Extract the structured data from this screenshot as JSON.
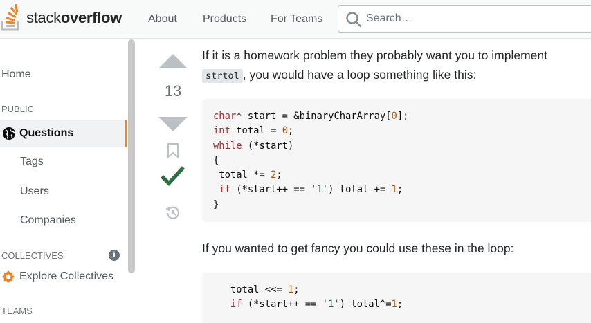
{
  "header": {
    "logo": {
      "light": "stack",
      "bold": "overflow"
    },
    "nav": [
      "About",
      "Products",
      "For Teams"
    ],
    "search_placeholder": "Search…"
  },
  "sidebar": {
    "home": "Home",
    "public_heading": "PUBLIC",
    "questions": "Questions",
    "items": [
      "Tags",
      "Users",
      "Companies"
    ],
    "collectives_heading": "COLLECTIVES",
    "explore": "Explore Collectives",
    "teams_heading": "TEAMS"
  },
  "votes": {
    "count": "13",
    "accepted": true
  },
  "post": {
    "para1_before": "If it is a homework problem they probably want you to implement ",
    "para1_code": "strtol",
    "para1_after": ", you would have a loop something like this:",
    "code1": [
      "char* start = &binaryCharArray[0];",
      "int total = 0;",
      "while (*start)",
      "{",
      " total *= 2;",
      " if (*start++ == '1') total += 1;",
      "}"
    ],
    "para2": "If you wanted to get fancy you could use these in the loop:",
    "code2": [
      "   total <<= 1;",
      "   if (*start++ == '1') total^=1;"
    ]
  },
  "colors": {
    "accent": "#f48225",
    "accepted_green": "#2f6f44",
    "vote_arrow": "#bbc0c4"
  },
  "icons": [
    "stackoverflow-logo-icon",
    "search-icon",
    "globe-icon",
    "info-icon",
    "collectives-icon",
    "upvote-icon",
    "downvote-icon",
    "bookmark-icon",
    "accepted-check-icon",
    "history-icon"
  ]
}
